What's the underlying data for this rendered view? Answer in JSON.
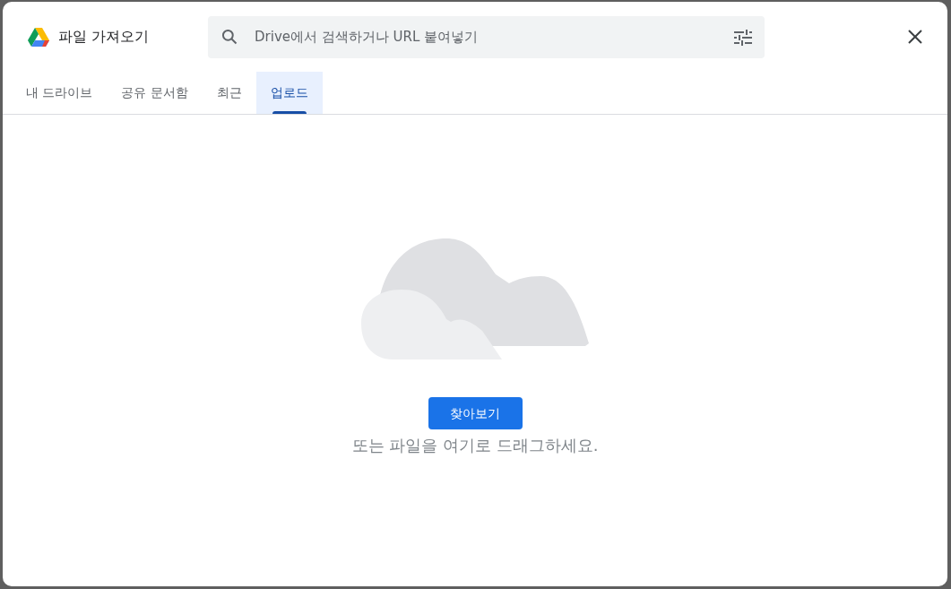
{
  "dialog": {
    "title": "파일 가져오기",
    "search": {
      "placeholder": "Drive에서 검색하거나 URL 붙여넣기"
    }
  },
  "tabs": [
    {
      "label": "내 드라이브",
      "selected": false
    },
    {
      "label": "공유 문서함",
      "selected": false
    },
    {
      "label": "최근",
      "selected": false
    },
    {
      "label": "업로드",
      "selected": true
    }
  ],
  "upload": {
    "button": "찾아보기",
    "hint": "또는 파일을 여기로 드래그하세요."
  }
}
